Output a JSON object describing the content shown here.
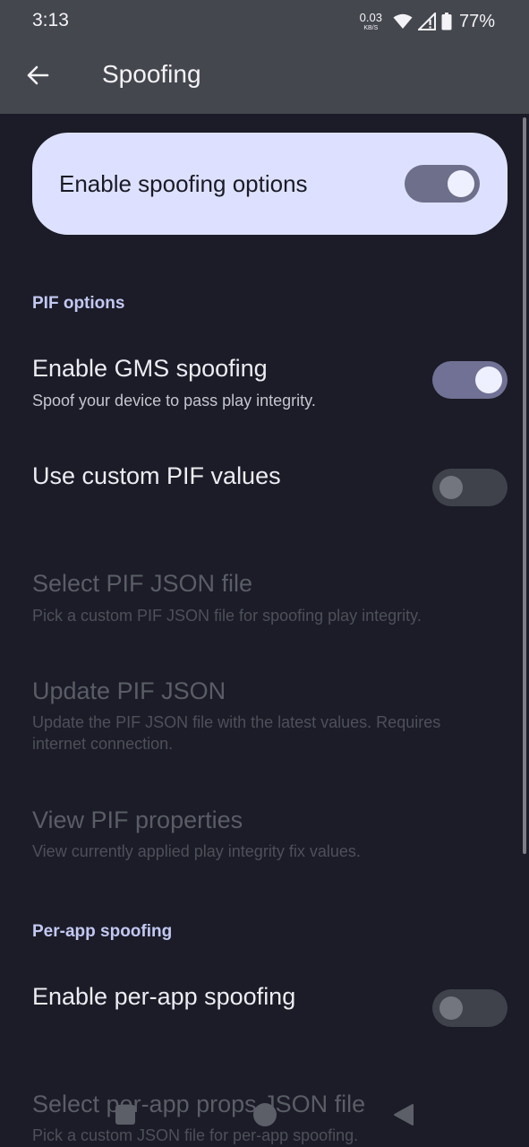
{
  "status_bar": {
    "time": "3:13",
    "net_speed_value": "0.03",
    "net_speed_unit": "KB/S",
    "battery_percent": "77%",
    "icons": [
      "wifi-icon",
      "cell-signal-icon",
      "battery-icon"
    ]
  },
  "toolbar": {
    "title": "Spoofing",
    "back_icon": "arrow-back-icon"
  },
  "main_switch": {
    "label": "Enable spoofing options",
    "checked": true
  },
  "sections": [
    {
      "header": "PIF options",
      "items": [
        {
          "title": "Enable GMS spoofing",
          "summary": "Spoof your device to pass play integrity.",
          "switch": true,
          "checked": true,
          "enabled": true
        },
        {
          "title": "Use custom PIF values",
          "summary": "",
          "switch": true,
          "checked": false,
          "enabled": true
        },
        {
          "title": "Select PIF JSON file",
          "summary": "Pick a custom PIF JSON file for spoofing play integrity.",
          "switch": false,
          "enabled": false
        },
        {
          "title": "Update PIF JSON",
          "summary": "Update the PIF JSON file with the latest values. Requires internet connection.",
          "switch": false,
          "enabled": false
        },
        {
          "title": "View PIF properties",
          "summary": "View currently applied play integrity fix values.",
          "switch": false,
          "enabled": false
        }
      ]
    },
    {
      "header": "Per-app spoofing",
      "items": [
        {
          "title": "Enable per-app spoofing",
          "summary": "",
          "switch": true,
          "checked": false,
          "enabled": true
        },
        {
          "title": "Select per-app props JSON file",
          "summary": "Pick a custom JSON file for per-app spoofing.",
          "switch": false,
          "enabled": false
        }
      ]
    }
  ],
  "nav_bar": {
    "icons": [
      "recents-icon",
      "home-icon",
      "back-triangle-icon"
    ]
  },
  "colors": {
    "app_bar": "#45474f",
    "background": "#1b1c27",
    "main_card": "#dde1ff",
    "accent_header": "#c3c8f2",
    "switch_on_track": "#707194",
    "switch_off_track": "#3f414b"
  }
}
